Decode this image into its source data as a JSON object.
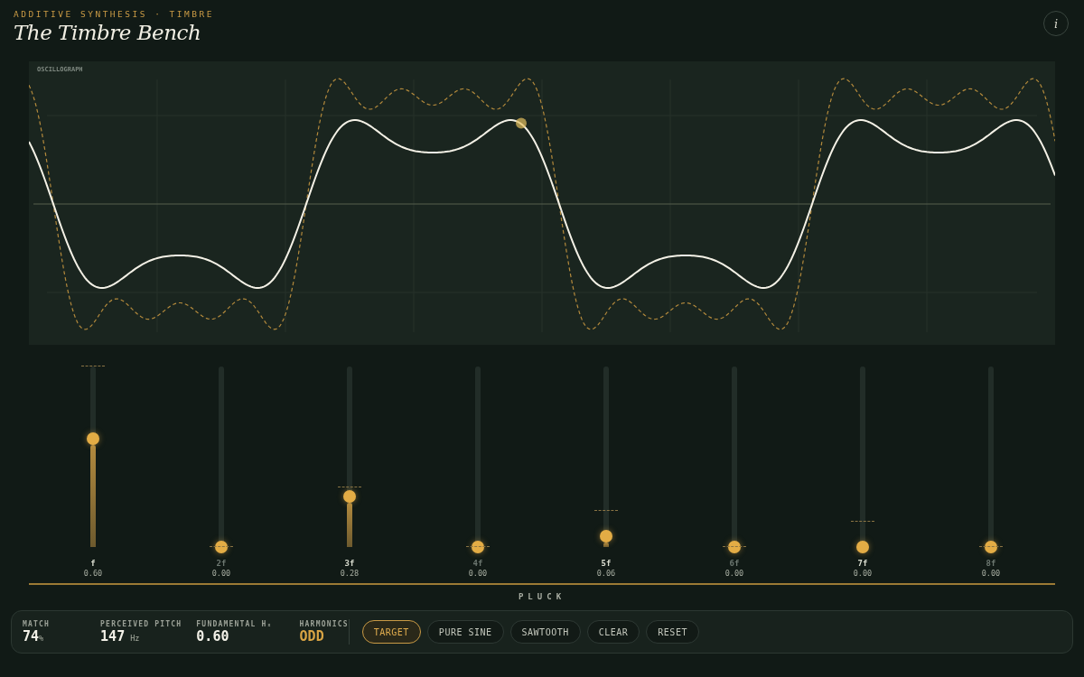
{
  "header": {
    "eyebrow": "ADDITIVE SYNTHESIS · TIMBRE",
    "title": "The Timbre Bench",
    "info_button": "i"
  },
  "oscillograph": {
    "label": "OSCILLOGRAPH"
  },
  "harmonics": [
    {
      "label": "f",
      "value": "0.60",
      "level": 0.6,
      "highlighted": true,
      "target": {
        "level": 1.0
      }
    },
    {
      "label": "2f",
      "value": "0.00",
      "level": 0,
      "highlighted": false,
      "target": {
        "level": 0
      }
    },
    {
      "label": "3f",
      "value": "0.28",
      "level": 0.28,
      "highlighted": true,
      "target": {
        "level": 0.33
      }
    },
    {
      "label": "4f",
      "value": "0.00",
      "level": 0,
      "highlighted": false,
      "target": {
        "level": 0
      }
    },
    {
      "label": "5f",
      "value": "0.06",
      "level": 0.06,
      "highlighted": true,
      "target": {
        "level": 0.2
      }
    },
    {
      "label": "6f",
      "value": "0.00",
      "level": 0,
      "highlighted": false,
      "target": {
        "level": 0
      }
    },
    {
      "label": "7f",
      "value": "0.00",
      "level": 0,
      "highlighted": true,
      "target": {
        "level": 0.14
      }
    },
    {
      "label": "8f",
      "value": "0.00",
      "level": 0,
      "highlighted": false,
      "target": {
        "level": 0
      }
    }
  ],
  "pluck": {
    "label": "PLUCK"
  },
  "stats": [
    {
      "label": "MATCH",
      "value": "74",
      "unit": "%",
      "accent": false
    },
    {
      "label": "PERCEIVED PITCH",
      "value": "147",
      "unit": "Hz",
      "accent": false
    },
    {
      "label": "FUNDAMENTAL Hₓ",
      "value": "0.60",
      "accent": false
    },
    {
      "label": "HARMONICS",
      "value": "ODD",
      "accent": true
    }
  ],
  "buttons": [
    {
      "label": "TARGET",
      "selected": true
    },
    {
      "label": "PURE SINE",
      "selected": false
    },
    {
      "label": "SAWTOOTH",
      "selected": false
    },
    {
      "label": "CLEAR",
      "selected": false
    },
    {
      "label": "RESET",
      "selected": false
    }
  ]
}
